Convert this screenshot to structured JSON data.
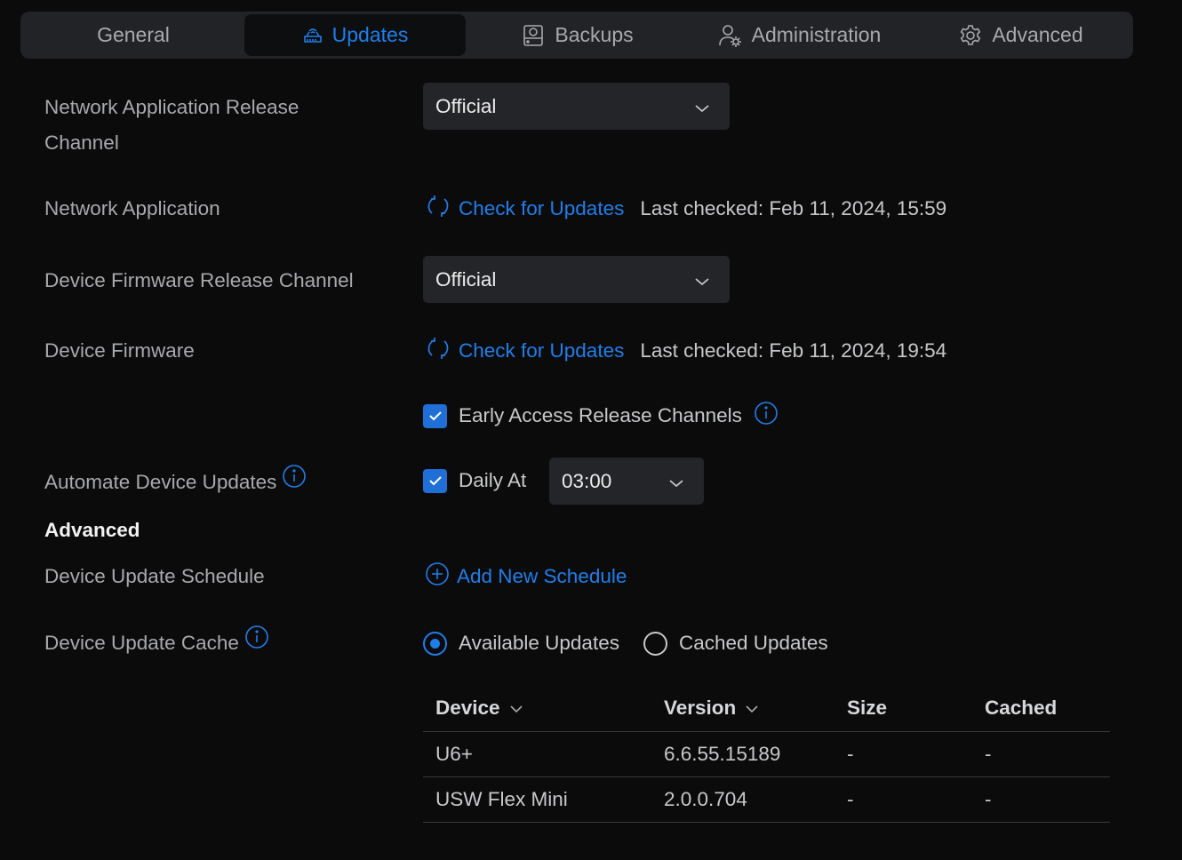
{
  "tabs": [
    {
      "label": "General",
      "icon": "",
      "active": false
    },
    {
      "label": "Updates",
      "icon": "router-update-icon",
      "active": true
    },
    {
      "label": "Backups",
      "icon": "backup-drive-icon",
      "active": false
    },
    {
      "label": "Administration",
      "icon": "admin-user-gear-icon",
      "active": false
    },
    {
      "label": "Advanced",
      "icon": "gear-icon",
      "active": false
    }
  ],
  "settings": {
    "net_app_channel_label": "Network Application Release Channel",
    "net_app_channel_value": "Official",
    "net_app_label": "Network Application",
    "net_app_check": "Check for Updates",
    "net_app_last_checked": "Last checked: Feb 11, 2024, 15:59",
    "fw_channel_label": "Device Firmware Release Channel",
    "fw_channel_value": "Official",
    "fw_label": "Device Firmware",
    "fw_check": "Check for Updates",
    "fw_last_checked": "Last checked: Feb 11, 2024, 19:54",
    "early_access_label": "Early Access Release Channels",
    "automate_label": "Automate Device Updates",
    "daily_at_label": "Daily At",
    "daily_at_time": "03:00"
  },
  "advanced": {
    "title": "Advanced",
    "schedule_label": "Device Update Schedule",
    "add_schedule": "Add New Schedule",
    "cache_label": "Device Update Cache",
    "cache_options": [
      "Available Updates",
      "Cached Updates"
    ],
    "cache_selected": "Available Updates"
  },
  "table": {
    "columns": [
      "Device",
      "Version",
      "Size",
      "Cached"
    ],
    "rows": [
      [
        "U6+",
        "6.6.55.15189",
        "-",
        "-"
      ],
      [
        "USW Flex Mini",
        "2.0.0.704",
        "-",
        "-"
      ]
    ]
  },
  "colors": {
    "accent": "#1f7eea",
    "background": "#0b0b0c",
    "panel": "#222326"
  }
}
